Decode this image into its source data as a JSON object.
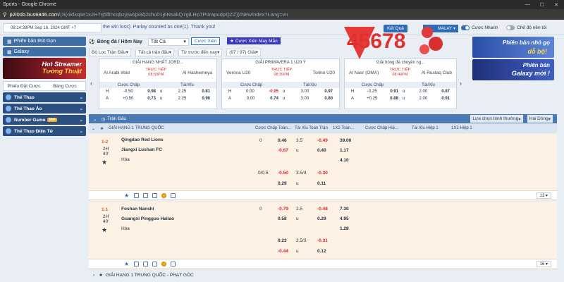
{
  "window": {
    "title": "Sports - Google Chrome"
  },
  "address": {
    "domain": "p2i0ob.bus6846.com",
    "path": "/(S(oidxqse1x2H7rj5lfmcqbzyjwopi3q2chu01j6NsakQ7giLRp7P0rapudpQZZ))/NewIndex?Lang=vn"
  },
  "topbar": {
    "datetime": "08:14:38PM Sep 16, 2024 GMT +7",
    "ticker": "the win loss). Parlay counted as one(1). Thank you!",
    "ketqua": "Kết Quả",
    "language": "MALAY",
    "toggle1": "Cược Nhanh",
    "toggle2": "Chế độ nền tối"
  },
  "logo": {
    "text": "45678"
  },
  "sidebar": {
    "version_btn": "Phiên bản Rút Gọn",
    "galaxy_btn": "Galaxy",
    "banner_line1": "Hot Streamer",
    "banner_line2": "Tường Thuật",
    "tabs": [
      "Phiếu Đặt Cược",
      "Bảng Cược"
    ],
    "categories": [
      {
        "label": "Thể Thao",
        "badge": ""
      },
      {
        "label": "Thể Thao Ảo",
        "badge": ""
      },
      {
        "label": "Number Game",
        "badge": "Mới"
      },
      {
        "label": "Thể Thao Điện Tử",
        "badge": ""
      }
    ]
  },
  "center": {
    "sport": "Bóng đá / Hôm Nay",
    "sport_filter": "Tất Cả",
    "cuoc_xien": "Cược Xiên",
    "cuoc_xien_may_man": "Cược Xiên May Mắn",
    "filters": [
      "Bộ Lọc Trận Đấu",
      "Tất cả trận đấu",
      "Từ trước đến nay",
      "(97 / 97) Giải"
    ]
  },
  "cards": [
    {
      "league": "GIẢI HẠNG NHẤT JORD...",
      "home": "Al Arabi Irbid",
      "away": "Al Hashemeya",
      "live": "TRỰC TIẾP",
      "time": "08:30PM",
      "h1": "Cược Chấp",
      "h2": "Tài/Xỉu",
      "rows": [
        {
          "s": "H",
          "hdp": "-0.50",
          "ho": "0.98",
          "ts": "o",
          "ou": "2.25",
          "oo": "0.81",
          "hneg": false
        },
        {
          "s": "A",
          "hdp": "+0.50",
          "ho": "0.73",
          "ts": "u",
          "ou": "2.25",
          "oo": "0.90",
          "hneg": false
        }
      ]
    },
    {
      "league": "GIẢI PRIMAVERA 1 U20 Ý",
      "home": "Verona U20",
      "away": "Torino U20",
      "live": "TRỰC TIẾP",
      "time": "08:30PM",
      "h1": "Cược Chấp",
      "h2": "Tài/Xỉu",
      "rows": [
        {
          "s": "H",
          "hdp": "0.00",
          "ho": "-0.95",
          "ts": "o",
          "ou": "3.00",
          "oo": "0.97",
          "hneg": true
        },
        {
          "s": "A",
          "hdp": "0.00",
          "ho": "0.74",
          "ts": "u",
          "ou": "3.00",
          "oo": "0.80",
          "hneg": false
        }
      ]
    },
    {
      "league": "Giải bóng đá chuyên ng...",
      "home": "Al Nasr (OMA)",
      "away": "Al Rustaq Club",
      "live": "TRỰC TIẾP",
      "time": "08:40PM",
      "h1": "Cược Chấp",
      "h2": "Tài/Xỉu",
      "rows": [
        {
          "s": "H",
          "hdp": "-0.25",
          "ho": "0.91",
          "ts": "o",
          "ou": "2.00",
          "oo": "0.87",
          "hneg": false
        },
        {
          "s": "A",
          "hdp": "+0.25",
          "ho": "0.88",
          "ts": "u",
          "ou": "2.00",
          "oo": "0.91",
          "hneg": false
        }
      ]
    }
  ],
  "ads": {
    "ad1_line1": "Phiên bản nhỏ gọ",
    "ad1_line2": "dỗ bộ!",
    "ad2_line1": "Phiên bản",
    "ad2_line2": "Galaxy mới !"
  },
  "odds": {
    "bar_label": "Trận Đấu",
    "sort_label": "Lựa chọn bình thường",
    "odds_type": "Hai Dòng",
    "league": "GIẢI HẠNG 1 TRUNG QUỐC",
    "cols": [
      "Cược Chấp Toàn...",
      "Tài Xỉu Toàn Trận",
      "1X2 Toàn...",
      "Cược Chấp Hiệ...",
      "Tài Xỉu Hiệp 1",
      "1X2 Hiệp 1"
    ],
    "matches": [
      {
        "score": "1-2",
        "half": "2H",
        "minute": "40'",
        "home": "Qingdao Red Lions",
        "away": "Jiangxi Lushan FC",
        "draw": "Hòa",
        "l1": {
          "hdp": "0",
          "ho": "0.46",
          "ou": "3.5",
          "oo": "-0.49",
          "x": "39.00"
        },
        "l2": {
          "ho": "-0.67",
          "ou": "u",
          "oo": "0.40",
          "x": "1.17"
        },
        "l3": {
          "x": "4.10"
        },
        "l4": {
          "hdp": "0/0.5",
          "ho": "-0.50",
          "ou": "3.5/4",
          "oo": "-0.30"
        },
        "l5": {
          "ho": "0.29",
          "ou": "u",
          "oo": "0.11"
        },
        "count": "13"
      },
      {
        "score": "1-1",
        "half": "2H",
        "minute": "40'",
        "home": "Foshan Nanshi",
        "away": "Guangxi Pingguo Haliao",
        "draw": "Hòa",
        "l1": {
          "hdp": "0",
          "ho": "-0.79",
          "ou": "2.5",
          "oo": "-0.48",
          "x": "7.30"
        },
        "l2": {
          "ho": "0.58",
          "ou": "u",
          "oo": "0.29",
          "x": "4.95"
        },
        "l3": {
          "x": "1.28"
        },
        "l4": {
          "hdp": "0.23",
          "ho": "",
          "ou": "2.5/3",
          "oo": "-0.31"
        },
        "l5": {
          "ho": "-0.44",
          "ou": "u",
          "oo": "0.12"
        },
        "count": "16"
      }
    ],
    "league2": "GIẢI HẠNG 1 TRUNG QUỐC - PHẠT GÓC"
  }
}
